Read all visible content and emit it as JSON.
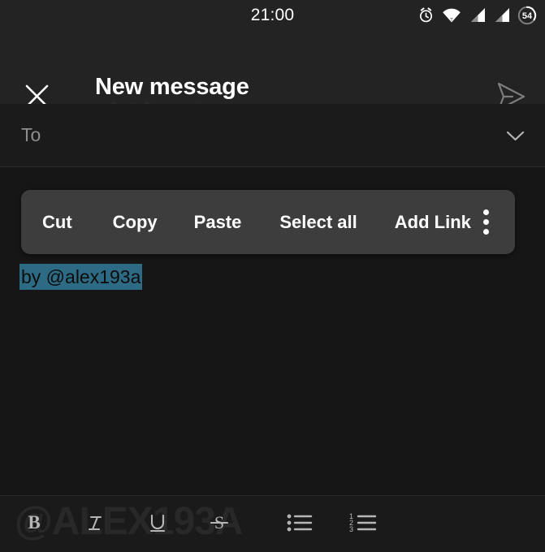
{
  "status_bar": {
    "clock": "21:00",
    "battery_level": "54",
    "icons": [
      "alarm-clock-icon",
      "wifi-icon",
      "signal-bars-icon",
      "signal-bars-icon",
      "battery-icon"
    ]
  },
  "header": {
    "close_icon": "close-icon",
    "title": "New message",
    "account_subtitle": "redacted account name",
    "account_chevron_icon": "chevron-down-icon",
    "send_icon": "send-icon"
  },
  "recipient": {
    "label": "To",
    "value": "",
    "expand_icon": "chevron-down-icon"
  },
  "editor": {
    "selected_text": "by @alex193a",
    "selection_color": "#2d6a84",
    "watermark": "@ALEX193A"
  },
  "context_menu": {
    "items": [
      {
        "label": "Cut"
      },
      {
        "label": "Copy"
      },
      {
        "label": "Paste"
      },
      {
        "label": "Select all"
      },
      {
        "label": "Add Link"
      }
    ],
    "overflow_icon": "more-vertical-icon"
  },
  "format_toolbar": {
    "buttons": [
      {
        "name": "bold-icon",
        "label": "B"
      },
      {
        "name": "italic-icon",
        "label": "I"
      },
      {
        "name": "underline-icon",
        "label": "U"
      },
      {
        "name": "strikethrough-icon",
        "label": "S"
      },
      {
        "name": "bulleted-list-icon",
        "label": ""
      },
      {
        "name": "numbered-list-icon",
        "label": ""
      }
    ],
    "list_numbers": [
      "1",
      "2",
      "3"
    ]
  },
  "colors": {
    "background": "#161616",
    "surface": "#232323",
    "menu_surface": "#3d3d3d",
    "accent_selection": "#2d6a84",
    "text_primary": "#ffffff",
    "text_secondary": "#8e8e8e"
  }
}
